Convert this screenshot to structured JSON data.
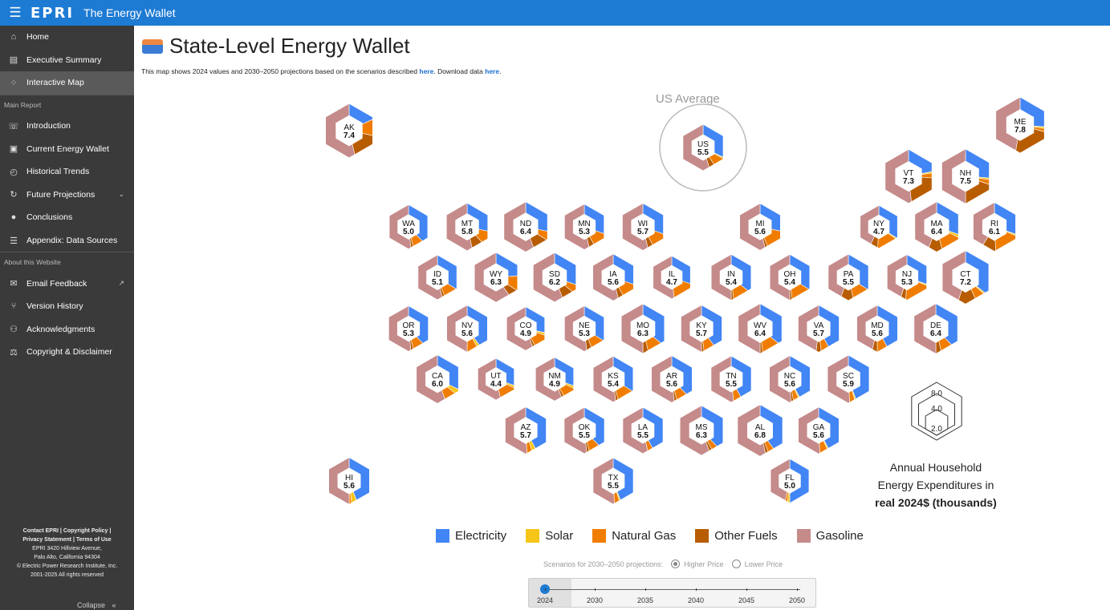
{
  "app": {
    "logo_text": "EPRI",
    "title": "The Energy Wallet"
  },
  "sidebar": {
    "items_top": [
      {
        "icon": "home-icon",
        "glyph": "⌂",
        "label": "Home"
      },
      {
        "icon": "document-icon",
        "glyph": "▤",
        "label": "Executive Summary"
      },
      {
        "icon": "map-icon",
        "glyph": "⁘",
        "label": "Interactive Map",
        "active": true
      }
    ],
    "section_main": "Main Report",
    "items_main": [
      {
        "icon": "phone-icon",
        "glyph": "☏",
        "label": "Introduction"
      },
      {
        "icon": "wallet-icon",
        "glyph": "▣",
        "label": "Current Energy Wallet"
      },
      {
        "icon": "history-icon",
        "glyph": "◴",
        "label": "Historical Trends"
      },
      {
        "icon": "future-icon",
        "glyph": "↻",
        "label": "Future Projections",
        "trail": "⌄"
      },
      {
        "icon": "lightbulb-icon",
        "glyph": "●",
        "label": "Conclusions"
      },
      {
        "icon": "list-icon",
        "glyph": "☰",
        "label": "Appendix: Data Sources"
      }
    ],
    "section_about": "About this Website",
    "items_about": [
      {
        "icon": "mail-icon",
        "glyph": "✉",
        "label": "Email Feedback",
        "trail": "↗"
      },
      {
        "icon": "branch-icon",
        "glyph": "⑂",
        "label": "Version History"
      },
      {
        "icon": "people-icon",
        "glyph": "⚇",
        "label": "Acknowledgments"
      },
      {
        "icon": "scale-icon",
        "glyph": "⚖",
        "label": "Copyright & Disclaimer"
      }
    ],
    "footer": {
      "line1": "Contact EPRI | Copyright Policy |",
      "line2": "Privacy Statement | Terms of Use",
      "line3": "EPRI 3420 Hillview Avenue,",
      "line4": "Palo Alto, California 94304",
      "line5": "© Electric Power Research Institute, Inc.",
      "line6": "2001-2025 All rights reserved"
    },
    "collapse_label": "Collapse",
    "collapse_glyph": "«"
  },
  "page": {
    "title": "State-Level Energy Wallet",
    "intro_before": "This map shows 2024 values and 2030–2050 projections based on the scenarios described ",
    "intro_link1": "here",
    "intro_middle": ". Download data ",
    "intro_link2": "here",
    "intro_after": ".",
    "us_average_label": "US Average"
  },
  "colors": {
    "electricity": "#4285f4",
    "solar": "#f5c518",
    "natural_gas": "#f07d00",
    "other_fuels": "#b85c00",
    "gasoline": "#c58a8a"
  },
  "legend": [
    {
      "key": "electricity",
      "label": "Electricity"
    },
    {
      "key": "solar",
      "label": "Solar"
    },
    {
      "key": "natural_gas",
      "label": "Natural Gas"
    },
    {
      "key": "other_fuels",
      "label": "Other Fuels"
    },
    {
      "key": "gasoline",
      "label": "Gasoline"
    }
  ],
  "scale": {
    "values": [
      "8.0",
      "4.0",
      "2.0"
    ],
    "caption1": "Annual Household",
    "caption2": "Energy Expenditures in",
    "caption3": "real 2024$ (thousands)"
  },
  "scenarios": {
    "label": "Scenarios for 2030–2050 projections:",
    "options": [
      {
        "label": "Higher Price",
        "selected": true
      },
      {
        "label": "Lower Price",
        "selected": false
      }
    ]
  },
  "timeline": {
    "years": [
      "2024",
      "2030",
      "2035",
      "2040",
      "2045",
      "2050"
    ],
    "selected": "2024"
  },
  "states": [
    {
      "abbr": "US",
      "value": "5.5",
      "mix": [
        0.32,
        0.01,
        0.08,
        0.04,
        0.55
      ],
      "pos": [
        709,
        152
      ]
    },
    {
      "abbr": "AK",
      "value": "7.4",
      "mix": [
        0.18,
        0.0,
        0.1,
        0.18,
        0.54
      ],
      "pos": [
        268,
        131
      ]
    },
    {
      "abbr": "ME",
      "value": "7.8",
      "mix": [
        0.26,
        0.01,
        0.02,
        0.24,
        0.47
      ],
      "pos": [
        1104,
        124
      ]
    },
    {
      "abbr": "VT",
      "value": "7.3",
      "mix": [
        0.22,
        0.01,
        0.03,
        0.22,
        0.52
      ],
      "pos": [
        965,
        188
      ]
    },
    {
      "abbr": "NH",
      "value": "7.5",
      "mix": [
        0.26,
        0.01,
        0.03,
        0.2,
        0.5
      ],
      "pos": [
        1036,
        188
      ]
    },
    {
      "abbr": "WA",
      "value": "5.0",
      "mix": [
        0.38,
        0.0,
        0.08,
        0.02,
        0.52
      ],
      "pos": [
        342,
        251
      ]
    },
    {
      "abbr": "MT",
      "value": "5.8",
      "mix": [
        0.28,
        0.0,
        0.1,
        0.08,
        0.54
      ],
      "pos": [
        415,
        251
      ]
    },
    {
      "abbr": "ND",
      "value": "6.4",
      "mix": [
        0.28,
        0.0,
        0.06,
        0.1,
        0.56
      ],
      "pos": [
        488,
        251
      ]
    },
    {
      "abbr": "MN",
      "value": "5.3",
      "mix": [
        0.3,
        0.0,
        0.12,
        0.04,
        0.54
      ],
      "pos": [
        561,
        251
      ]
    },
    {
      "abbr": "WI",
      "value": "5.7",
      "mix": [
        0.3,
        0.0,
        0.12,
        0.04,
        0.54
      ],
      "pos": [
        634,
        251
      ]
    },
    {
      "abbr": "MI",
      "value": "5.6",
      "mix": [
        0.28,
        0.0,
        0.16,
        0.02,
        0.54
      ],
      "pos": [
        780,
        251
      ]
    },
    {
      "abbr": "NY",
      "value": "4.7",
      "mix": [
        0.34,
        0.01,
        0.16,
        0.06,
        0.43
      ],
      "pos": [
        928,
        251
      ]
    },
    {
      "abbr": "MA",
      "value": "6.4",
      "mix": [
        0.3,
        0.02,
        0.14,
        0.1,
        0.44
      ],
      "pos": [
        1000,
        251
      ]
    },
    {
      "abbr": "RI",
      "value": "6.1",
      "mix": [
        0.3,
        0.01,
        0.18,
        0.1,
        0.41
      ],
      "pos": [
        1072,
        251
      ]
    },
    {
      "abbr": "ID",
      "value": "5.1",
      "mix": [
        0.34,
        0.0,
        0.1,
        0.02,
        0.54
      ],
      "pos": [
        378,
        314
      ]
    },
    {
      "abbr": "WY",
      "value": "6.3",
      "mix": [
        0.24,
        0.0,
        0.1,
        0.06,
        0.6
      ],
      "pos": [
        451,
        314
      ]
    },
    {
      "abbr": "SD",
      "value": "6.2",
      "mix": [
        0.3,
        0.0,
        0.06,
        0.08,
        0.56
      ],
      "pos": [
        524,
        314
      ]
    },
    {
      "abbr": "IA",
      "value": "5.6",
      "mix": [
        0.3,
        0.0,
        0.12,
        0.04,
        0.54
      ],
      "pos": [
        597,
        314
      ]
    },
    {
      "abbr": "IL",
      "value": "4.7",
      "mix": [
        0.3,
        0.0,
        0.18,
        0.0,
        0.52
      ],
      "pos": [
        670,
        314
      ]
    },
    {
      "abbr": "IN",
      "value": "5.4",
      "mix": [
        0.36,
        0.0,
        0.12,
        0.02,
        0.5
      ],
      "pos": [
        744,
        314
      ]
    },
    {
      "abbr": "OH",
      "value": "5.4",
      "mix": [
        0.34,
        0.0,
        0.14,
        0.02,
        0.5
      ],
      "pos": [
        817,
        314
      ]
    },
    {
      "abbr": "PA",
      "value": "5.5",
      "mix": [
        0.34,
        0.0,
        0.12,
        0.1,
        0.44
      ],
      "pos": [
        890,
        314
      ]
    },
    {
      "abbr": "NJ",
      "value": "5.3",
      "mix": [
        0.3,
        0.01,
        0.2,
        0.04,
        0.45
      ],
      "pos": [
        963,
        314
      ]
    },
    {
      "abbr": "CT",
      "value": "7.2",
      "mix": [
        0.36,
        0.01,
        0.06,
        0.12,
        0.45
      ],
      "pos": [
        1036,
        314
      ]
    },
    {
      "abbr": "OR",
      "value": "5.3",
      "mix": [
        0.38,
        0.0,
        0.08,
        0.02,
        0.52
      ],
      "pos": [
        342,
        378
      ]
    },
    {
      "abbr": "NV",
      "value": "5.6",
      "mix": [
        0.4,
        0.02,
        0.08,
        0.0,
        0.5
      ],
      "pos": [
        415,
        378
      ]
    },
    {
      "abbr": "CO",
      "value": "4.9",
      "mix": [
        0.28,
        0.02,
        0.12,
        0.02,
        0.56
      ],
      "pos": [
        488,
        378
      ]
    },
    {
      "abbr": "NE",
      "value": "5.3",
      "mix": [
        0.34,
        0.0,
        0.1,
        0.04,
        0.52
      ],
      "pos": [
        561,
        378
      ]
    },
    {
      "abbr": "MO",
      "value": "6.3",
      "mix": [
        0.36,
        0.0,
        0.1,
        0.04,
        0.5
      ],
      "pos": [
        634,
        378
      ]
    },
    {
      "abbr": "KY",
      "value": "5.7",
      "mix": [
        0.4,
        0.0,
        0.08,
        0.02,
        0.5
      ],
      "pos": [
        707,
        378
      ]
    },
    {
      "abbr": "WV",
      "value": "6.4",
      "mix": [
        0.36,
        0.0,
        0.12,
        0.02,
        0.5
      ],
      "pos": [
        780,
        378
      ]
    },
    {
      "abbr": "VA",
      "value": "5.7",
      "mix": [
        0.42,
        0.0,
        0.06,
        0.04,
        0.48
      ],
      "pos": [
        853,
        378
      ]
    },
    {
      "abbr": "MD",
      "value": "5.6",
      "mix": [
        0.42,
        0.0,
        0.08,
        0.04,
        0.46
      ],
      "pos": [
        926,
        378
      ]
    },
    {
      "abbr": "DE",
      "value": "6.4",
      "mix": [
        0.38,
        0.0,
        0.08,
        0.04,
        0.5
      ],
      "pos": [
        999,
        378
      ]
    },
    {
      "abbr": "CA",
      "value": "6.0",
      "mix": [
        0.32,
        0.04,
        0.08,
        0.0,
        0.56
      ],
      "pos": [
        378,
        441
      ]
    },
    {
      "abbr": "UT",
      "value": "4.4",
      "mix": [
        0.3,
        0.02,
        0.14,
        0.0,
        0.54
      ],
      "pos": [
        451,
        441
      ]
    },
    {
      "abbr": "NM",
      "value": "4.9",
      "mix": [
        0.3,
        0.02,
        0.1,
        0.02,
        0.56
      ],
      "pos": [
        524,
        441
      ]
    },
    {
      "abbr": "KS",
      "value": "5.4",
      "mix": [
        0.34,
        0.0,
        0.12,
        0.02,
        0.52
      ],
      "pos": [
        597,
        441
      ]
    },
    {
      "abbr": "AR",
      "value": "5.6",
      "mix": [
        0.38,
        0.0,
        0.08,
        0.02,
        0.52
      ],
      "pos": [
        670,
        441
      ]
    },
    {
      "abbr": "TN",
      "value": "5.5",
      "mix": [
        0.42,
        0.0,
        0.06,
        0.0,
        0.52
      ],
      "pos": [
        744,
        441
      ]
    },
    {
      "abbr": "NC",
      "value": "5.6",
      "mix": [
        0.42,
        0.01,
        0.04,
        0.02,
        0.51
      ],
      "pos": [
        817,
        441
      ]
    },
    {
      "abbr": "SC",
      "value": "5.9",
      "mix": [
        0.44,
        0.01,
        0.04,
        0.0,
        0.51
      ],
      "pos": [
        890,
        441
      ]
    },
    {
      "abbr": "AZ",
      "value": "5.7",
      "mix": [
        0.42,
        0.03,
        0.04,
        0.0,
        0.51
      ],
      "pos": [
        488,
        505
      ]
    },
    {
      "abbr": "OK",
      "value": "5.5",
      "mix": [
        0.38,
        0.0,
        0.08,
        0.02,
        0.52
      ],
      "pos": [
        561,
        505
      ]
    },
    {
      "abbr": "LA",
      "value": "5.5",
      "mix": [
        0.42,
        0.0,
        0.04,
        0.0,
        0.54
      ],
      "pos": [
        634,
        505
      ]
    },
    {
      "abbr": "MS",
      "value": "6.3",
      "mix": [
        0.38,
        0.0,
        0.04,
        0.02,
        0.56
      ],
      "pos": [
        707,
        505
      ]
    },
    {
      "abbr": "AL",
      "value": "6.8",
      "mix": [
        0.4,
        0.0,
        0.04,
        0.02,
        0.54
      ],
      "pos": [
        780,
        505
      ]
    },
    {
      "abbr": "GA",
      "value": "5.6",
      "mix": [
        0.42,
        0.01,
        0.06,
        0.0,
        0.51
      ],
      "pos": [
        853,
        505
      ]
    },
    {
      "abbr": "HI",
      "value": "5.6",
      "mix": [
        0.44,
        0.04,
        0.02,
        0.0,
        0.5
      ],
      "pos": [
        268,
        568
      ]
    },
    {
      "abbr": "TX",
      "value": "5.5",
      "mix": [
        0.44,
        0.01,
        0.04,
        0.0,
        0.51
      ],
      "pos": [
        597,
        568
      ]
    },
    {
      "abbr": "FL",
      "value": "5.0",
      "mix": [
        0.5,
        0.02,
        0.02,
        0.0,
        0.46
      ],
      "pos": [
        817,
        568
      ]
    }
  ]
}
